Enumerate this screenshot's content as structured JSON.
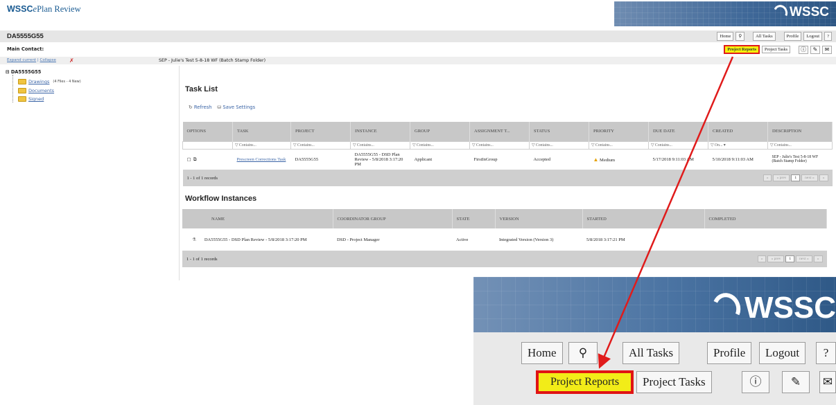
{
  "brand": {
    "wssc": "WSSC",
    "e": "e",
    "plan_review": "Plan Review"
  },
  "logo_text": "WSSC",
  "project_id": "DA5555G55",
  "top_buttons": [
    "Home",
    "All Tasks",
    "Profile",
    "Logout"
  ],
  "main_contact": "Main Contact:",
  "sub_buttons": {
    "project_reports": "Project Reports",
    "project_tasks": "Project Tasks"
  },
  "expand": {
    "current": "Expand current",
    "collapse": "Collapse"
  },
  "sep_text": "SEP - Julie's Test 5-8-18 WF (Batch Stamp Folder)",
  "tree": {
    "root": "DA5555G55",
    "drawings": "Drawings",
    "drawings_note": "(4 Files - 4 New)",
    "documents": "Documents",
    "signed": "Signed"
  },
  "task_list": {
    "title": "Task List",
    "refresh": "Refresh",
    "save_settings": "Save Settings",
    "columns": [
      "OPTIONS",
      "TASK",
      "PROJECT",
      "INSTANCE",
      "GROUP",
      "ASSIGNMENT T...",
      "STATUS",
      "PRIORITY",
      "DUE DATE",
      "CREATED",
      "DESCRIPTION"
    ],
    "filters": [
      "",
      "Contains...",
      "Contains...",
      "Contains...",
      "Contains...",
      "Contains...",
      "Contains...",
      "Contains...",
      "Contains...",
      "On...",
      "Contains..."
    ],
    "row": {
      "task": "Prescreen Corrections Task",
      "project": "DA5555G55",
      "instance": "DA5555G55 - DSD Plan Review - 5/8/2018 3:17:20 PM",
      "group": "Applicant",
      "assignment": "FirstInGroup",
      "status": "Accepted",
      "priority": "Medium",
      "due": "5/17/2018 9:11:03 AM",
      "created": "5/10/2018 9:11:03 AM",
      "description": "SEP - Julie's Test 5-8-18 WF (Batch Stamp Folder)"
    },
    "records": "1 - 1 of 1 records"
  },
  "pager": {
    "prev": "« prev",
    "page": "1",
    "next": "next »"
  },
  "workflow": {
    "title": "Workflow Instances",
    "columns": [
      "NAME",
      "COORDINATOR GROUP",
      "STATE",
      "VERSION",
      "STARTED",
      "COMPLETED"
    ],
    "row": {
      "name": "DA5555G55 - DSD Plan Review - 5/8/2018 3:17:20 PM",
      "group": "DSD - Project Manager",
      "state": "Active",
      "version": "Integrated Version (Version 3)",
      "started": "5/8/2018 3:17:21 PM",
      "completed": ""
    },
    "records": "1 - 1 of 1 records"
  },
  "zoom": {
    "home": "Home",
    "all_tasks": "All Tasks",
    "profile": "Profile",
    "logout": "Logout",
    "project_reports": "Project Reports",
    "project_tasks": "Project Tasks"
  },
  "colors": {
    "highlight": "#f5f10b",
    "callout": "#e01b1b",
    "brand": "#1a5b92"
  }
}
